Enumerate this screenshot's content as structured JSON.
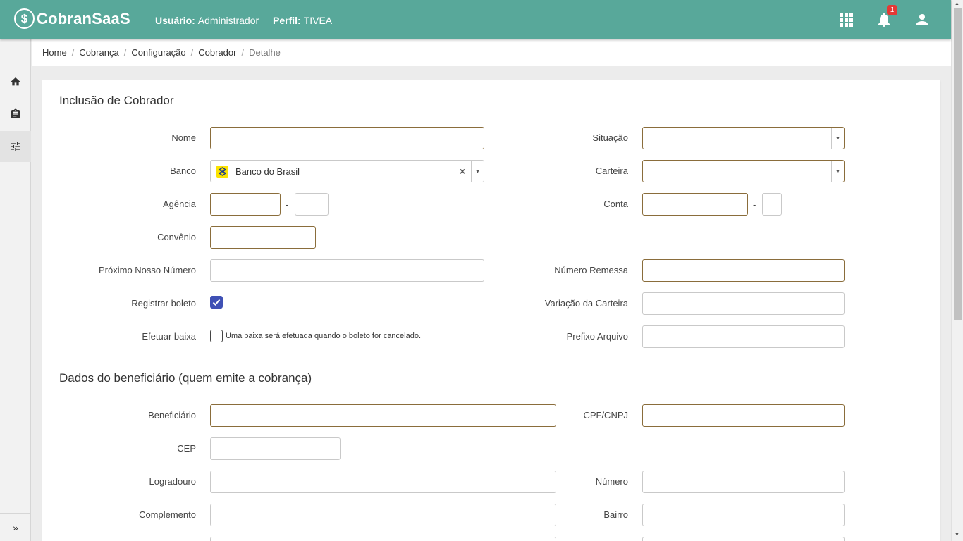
{
  "app": {
    "name": "CobranSaaS"
  },
  "header": {
    "user_label": "Usuário:",
    "user_value": "Administrador",
    "profile_label": "Perfil:",
    "profile_value": "TIVEA",
    "notification_count": "1"
  },
  "sidebar": {
    "items": [
      {
        "icon": "home-icon"
      },
      {
        "icon": "clipboard-icon"
      },
      {
        "icon": "sliders-icon",
        "active": true
      }
    ],
    "expand": "»"
  },
  "breadcrumb": [
    "Home",
    "Cobrança",
    "Configuração",
    "Cobrador",
    "Detalhe"
  ],
  "form": {
    "title": "Inclusão de Cobrador",
    "labels": {
      "nome": "Nome",
      "banco": "Banco",
      "agencia": "Agência",
      "convenio": "Convênio",
      "proximo_nosso_numero": "Próximo Nosso Número",
      "registrar_boleto": "Registrar boleto",
      "efetuar_baixa": "Efetuar baixa",
      "situacao": "Situação",
      "carteira": "Carteira",
      "conta": "Conta",
      "numero_remessa": "Número Remessa",
      "variacao_carteira": "Variação da Carteira",
      "prefixo_arquivo": "Prefixo Arquivo"
    },
    "values": {
      "nome": "",
      "banco": "Banco do Brasil",
      "situacao": "",
      "carteira": "",
      "registrar_boleto": true,
      "efetuar_baixa": false
    },
    "dash": "-",
    "efetuar_baixa_note": "Uma baixa será efetuada quando o boleto for cancelado."
  },
  "beneficiario": {
    "title": "Dados do beneficiário (quem emite a cobrança)",
    "labels": {
      "beneficiario": "Beneficiário",
      "cpf_cnpj": "CPF/CNPJ",
      "cep": "CEP",
      "logradouro": "Logradouro",
      "numero": "Número",
      "complemento": "Complemento",
      "bairro": "Bairro"
    }
  },
  "colors": {
    "header": "#58a89a",
    "required_border": "#8a6d3b",
    "checkbox": "#3f51b5",
    "badge": "#e53935"
  }
}
